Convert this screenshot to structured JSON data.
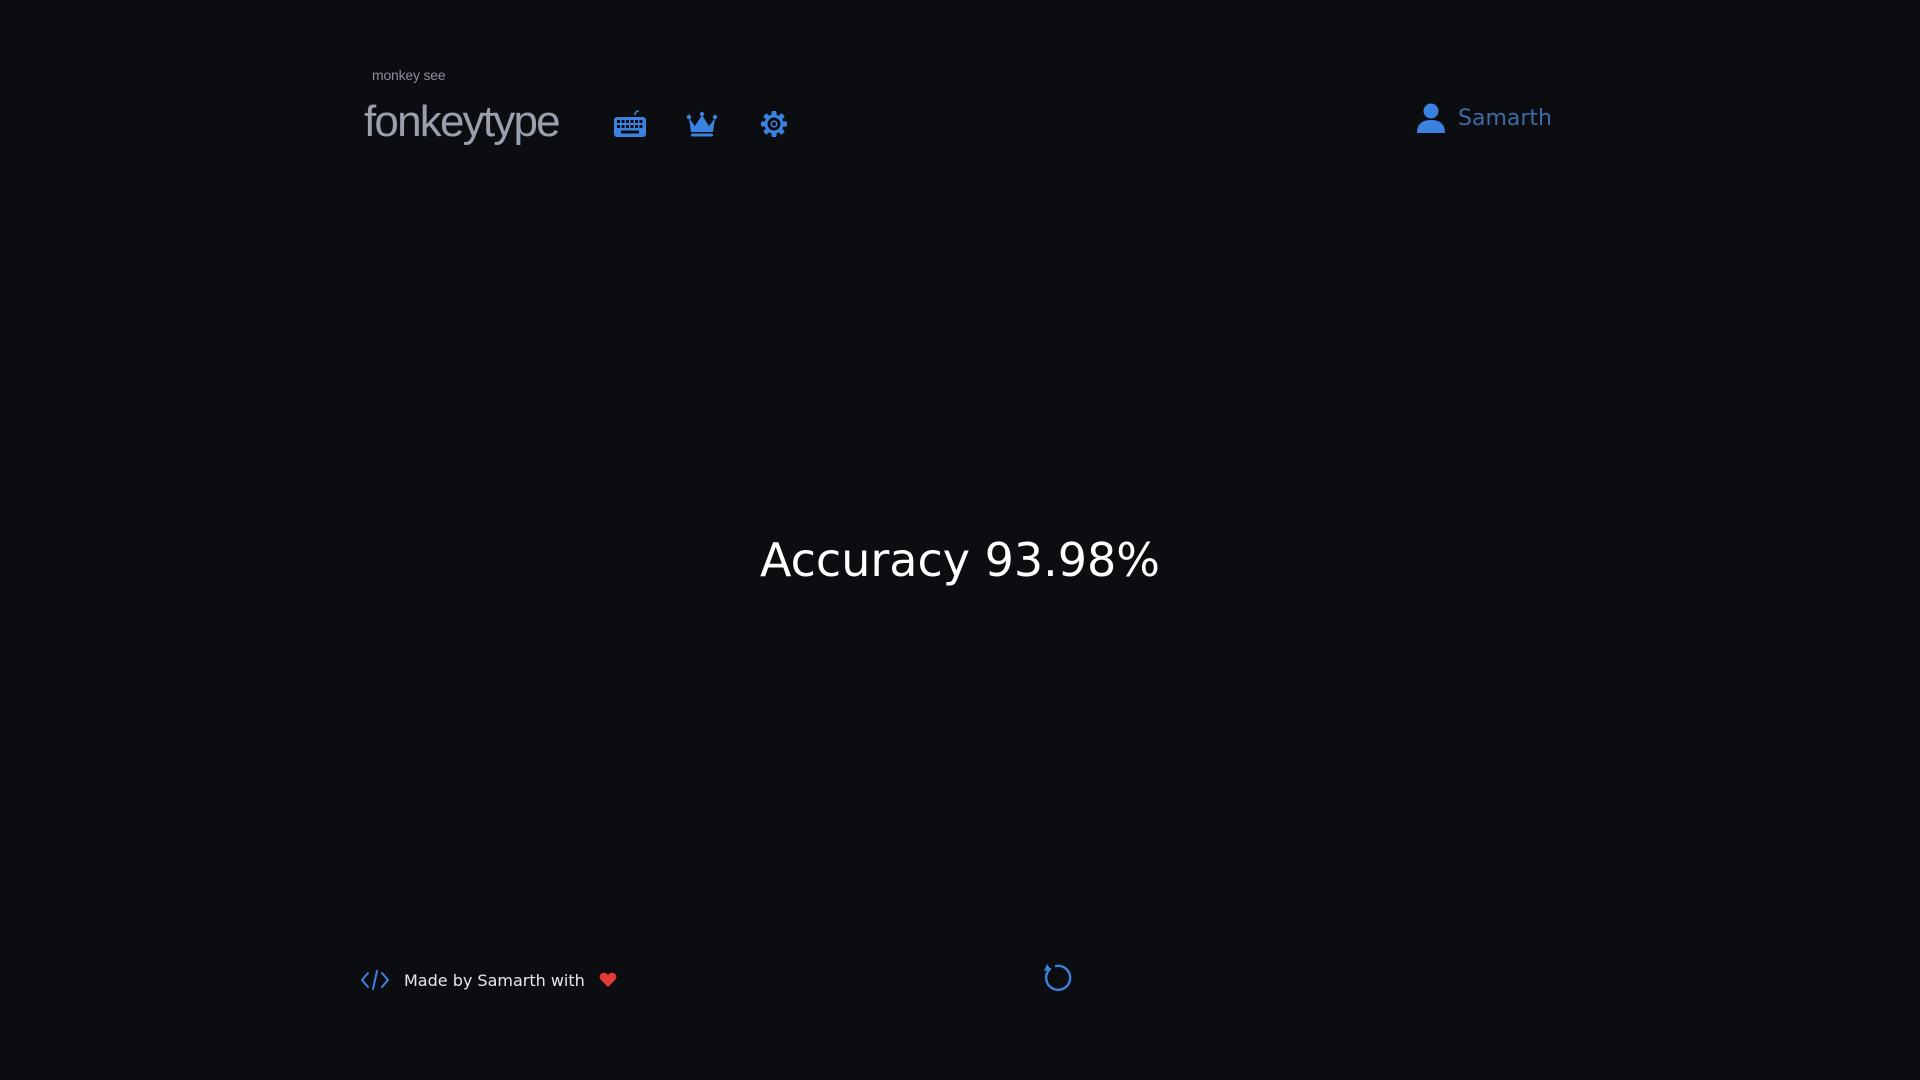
{
  "header": {
    "tagline": "monkey see",
    "logo": "fonkeytype",
    "nav": [
      {
        "icon": "keyboard-icon"
      },
      {
        "icon": "crown-icon"
      },
      {
        "icon": "gear-icon"
      }
    ],
    "user": {
      "icon": "user-icon",
      "name": "Samarth"
    }
  },
  "main": {
    "result_text": "Accuracy 93.98%"
  },
  "footer": {
    "code_icon": "code-icon",
    "credit": "Made by Samarth with",
    "heart_icon": "heart-icon",
    "restart_icon": "restart-icon"
  },
  "colors": {
    "background": "#0c0d11",
    "accent": "#3b82e0",
    "logo": "#9aa0ab",
    "user_name": "#3f6aa6",
    "heart": "#e53935",
    "text": "#ffffff"
  }
}
